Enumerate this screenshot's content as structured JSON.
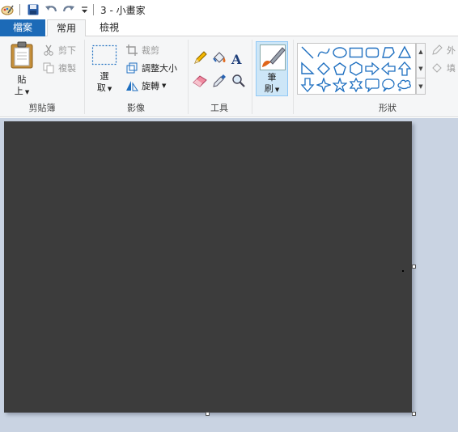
{
  "window": {
    "title": "3 - 小畫家"
  },
  "quick_access": {
    "icons": [
      "paint-app-icon",
      "save-icon",
      "undo-icon",
      "redo-icon",
      "customize-dropdown-icon"
    ]
  },
  "tabs": {
    "file": "檔案",
    "home": "常用",
    "view": "檢視"
  },
  "clipboard": {
    "paste_line1": "貼",
    "paste_line2": "上",
    "cut": "剪下",
    "copy": "複製",
    "group_label": "剪貼簿"
  },
  "image": {
    "select_line1": "選",
    "select_line2": "取",
    "crop": "裁剪",
    "resize": "調整大小",
    "rotate": "旋轉",
    "group_label": "影像"
  },
  "tools": {
    "group_label": "工具"
  },
  "brushes": {
    "line1": "筆",
    "line2": "刷"
  },
  "shapes": {
    "group_label": "形狀",
    "outline": "外",
    "fill": "填",
    "items": [
      "line",
      "curve",
      "oval",
      "rectangle",
      "rounded-rectangle",
      "polygon",
      "triangle",
      "right-triangle",
      "diamond",
      "pentagon",
      "hexagon",
      "right-arrow",
      "left-arrow",
      "up-arrow",
      "down-arrow",
      "four-point-star",
      "five-point-star",
      "six-point-star",
      "rounded-callout",
      "oval-callout",
      "cloud-callout"
    ]
  },
  "colors": {
    "accent": "#1c6ab7",
    "canvas": "#3c3c3c",
    "workspace": "#c9d3e2",
    "icon_blue": "#1e6fc0"
  }
}
